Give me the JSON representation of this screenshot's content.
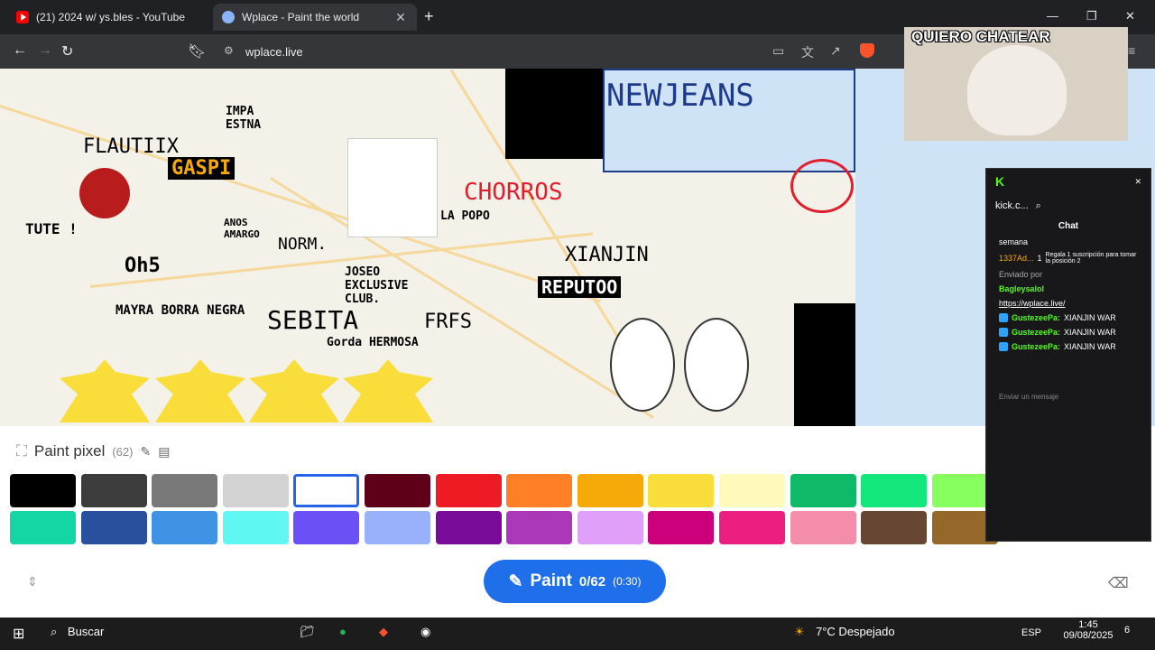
{
  "browser": {
    "tabs": [
      {
        "title": "(21) 2024 w/ ys.bles - YouTube",
        "active": false
      },
      {
        "title": "Wplace - Paint the world",
        "active": true
      }
    ],
    "url": "wplace.live"
  },
  "canvas_art": {
    "labels": [
      "NEWJEANS",
      "FLAUTIIX",
      "GASPI",
      "IMPA ESTNA",
      "CHORROS",
      "LA POPO",
      "NORM.",
      "XIANJIN",
      "REPUTOO",
      "JOSEO EXCLUSIVE CLUB.",
      "SEBITA",
      "MAYRA BORRA NEGRA",
      "FRFS",
      "Gorda HERMOSA",
      "Oh5",
      "TUTE !",
      "ANOS AMARGO"
    ]
  },
  "paint_panel": {
    "title": "Paint pixel",
    "count": "(62)",
    "palette_row1": [
      "#000000",
      "#3c3c3c",
      "#787878",
      "#d2d2d2",
      "#ffffff",
      "#600018",
      "#ed1c24",
      "#ff7f27",
      "#f6aa09",
      "#f9dd3b",
      "#fffabc",
      "#0eb968",
      "#13e67b",
      "#87ff5e"
    ],
    "palette_row2": [
      "#12d7a4",
      "#28509e",
      "#4093e4",
      "#60f7f2",
      "#6b50f6",
      "#99b1fb",
      "#780c99",
      "#aa38b9",
      "#e09ff9",
      "#cb007a",
      "#ec1f80",
      "#f38da9",
      "#684634",
      "#95682a"
    ],
    "selected_index": 4,
    "button_label": "Paint",
    "button_count": "0/62",
    "button_timer": "(0:30)"
  },
  "cam_overlay": {
    "title": "QUIERO CHATEAR"
  },
  "chat_overlay": {
    "site": "kick.c...",
    "label": "Chat",
    "week": "semana",
    "top_user": "1337Ad...",
    "top_amount": "1",
    "gift_note": "Regala 1 suscripción para tomar la posición 2",
    "sent_by": "Enviado por",
    "sender": "Bagleysalol",
    "link": "https://wplace.live/",
    "messages": [
      {
        "user": "GustezeePa:",
        "text": "XIANJIN WAR"
      },
      {
        "user": "GustezeePa:",
        "text": "XIANJIN WAR"
      },
      {
        "user": "GustezeePa:",
        "text": "XIANJIN WAR"
      }
    ],
    "input_placeholder": "Enviar un mensaje"
  },
  "taskbar": {
    "search": "Buscar",
    "weather": "7°C Despejado",
    "lang": "ESP",
    "time": "1:45",
    "date": "09/08/2025",
    "notif": "6"
  }
}
